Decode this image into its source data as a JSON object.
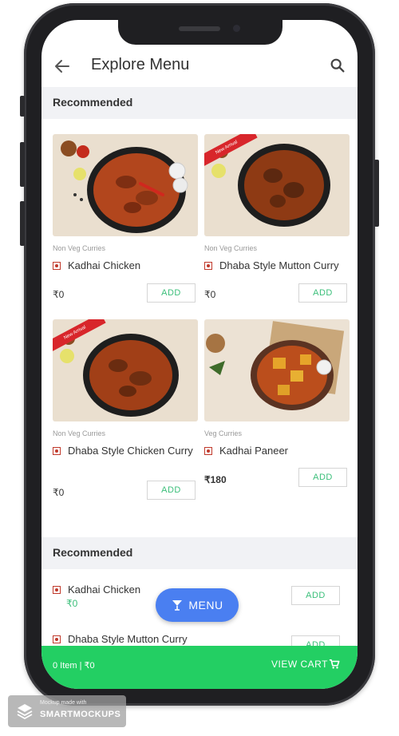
{
  "header": {
    "title": "Explore Menu"
  },
  "recommended_section": {
    "title": "Recommended"
  },
  "cards": [
    {
      "category": "Non Veg Curries",
      "name": "Kadhai Chicken",
      "price": "₹0",
      "add": "ADD",
      "ribbon": ""
    },
    {
      "category": "Non Veg Curries",
      "name": "Dhaba Style Mutton Curry",
      "price": "₹0",
      "add": "ADD",
      "ribbon": "New Arrival"
    },
    {
      "category": "Non Veg Curries",
      "name": "Dhaba Style Chicken Curry",
      "price": "₹0",
      "add": "ADD",
      "ribbon": "New Arrival"
    },
    {
      "category": "Veg Curries",
      "name": "Kadhai Paneer",
      "price": "₹180",
      "add": "ADD",
      "ribbon": ""
    }
  ],
  "list_section": {
    "title": "Recommended",
    "items": [
      {
        "name": "Kadhai Chicken",
        "price": "₹0",
        "add": "ADD"
      },
      {
        "name": "Dhaba Style Mutton Curry",
        "price": "",
        "add": "ADD"
      }
    ]
  },
  "menu_button": {
    "label": "MENU"
  },
  "cart_bar": {
    "summary": "0 Item | ₹0",
    "view_cart": "VIEW CART"
  },
  "watermark": {
    "small": "Mockup made with",
    "brand": "SMARTMOCKUPS"
  },
  "colors": {
    "accent_green": "#23cf63",
    "menu_blue": "#4a7ff1",
    "nonveg_red": "#c0392b"
  }
}
